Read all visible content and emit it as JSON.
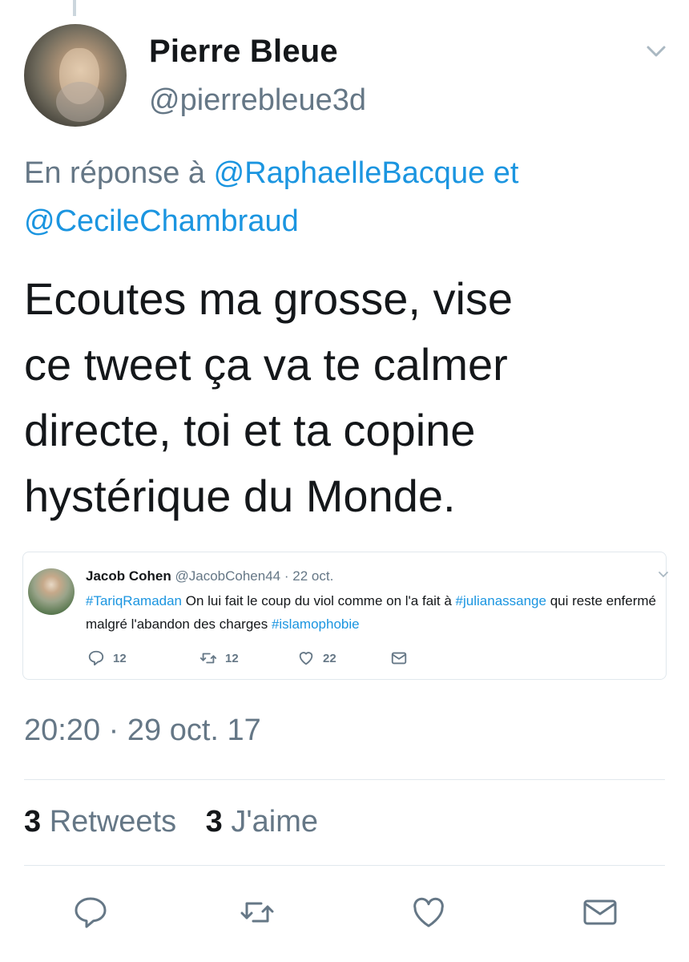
{
  "author": {
    "name": "Pierre Bleue",
    "handle": "@pierrebleue3d"
  },
  "reply": {
    "prefix": "En réponse à",
    "mention1": "@RaphaelleBacque",
    "conj": "et",
    "mention2": "@CecileChambraud"
  },
  "tweet": {
    "line1": "Ecoutes ma grosse, vise",
    "line2": "ce tweet ça va te calmer",
    "line3": "directe, toi et ta copine",
    "line4": "hystérique du Monde."
  },
  "quoted": {
    "name": "Jacob Cohen",
    "handle": "@JacobCohen44",
    "dot": "·",
    "date": "22 oct.",
    "tag1": "#TariqRamadan",
    "text1": " On lui fait le coup du viol comme on l'a fait à ",
    "tag2": "#julianassange",
    "text2": " qui reste enfermé malgré l'abandon des charges ",
    "tag3": "#islamophobie",
    "replies": "12",
    "retweets": "12",
    "likes": "22"
  },
  "timestamp": "20:20 · 29 oct. 17",
  "stats": {
    "retweets_count": "3",
    "retweets_label": "Retweets",
    "likes_count": "3",
    "likes_label": "J'aime"
  },
  "colors": {
    "link": "#1b95e0",
    "secondary": "#657786",
    "text": "#14171a",
    "border": "#e1e8ed"
  },
  "icons": [
    "chevron-down-icon",
    "reply-icon",
    "retweet-icon",
    "heart-icon",
    "mail-icon"
  ]
}
